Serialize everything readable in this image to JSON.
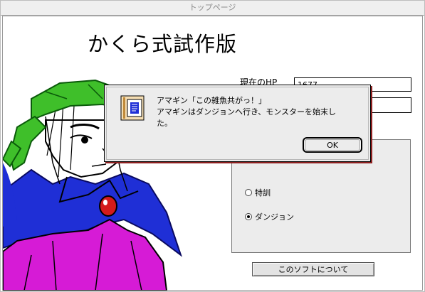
{
  "window": {
    "title": "トップページ"
  },
  "app": {
    "title": "かくら式試作版"
  },
  "status": {
    "hp_label": "現在のHP",
    "hp_value": "1677"
  },
  "actions": {
    "options": [
      {
        "label": "特訓",
        "selected": false
      },
      {
        "label": "ダンジョン",
        "selected": true
      }
    ]
  },
  "footer": {
    "about_label": "このソフトについて"
  },
  "dialog": {
    "lines": [
      "アマギン「この雑魚共がっ！」",
      "アマギンはダンジョンへ行き、モンスターを始末し",
      "た。"
    ],
    "ok_label": "OK",
    "icon": "note-document-icon"
  },
  "colors": {
    "bandana_green": "#3fbf2a",
    "cape_blue": "#1f2fd6",
    "shirt_magenta": "#d61bd6",
    "gem_red": "#d41b1b",
    "dialog_shadow": "#8e1f1f"
  }
}
